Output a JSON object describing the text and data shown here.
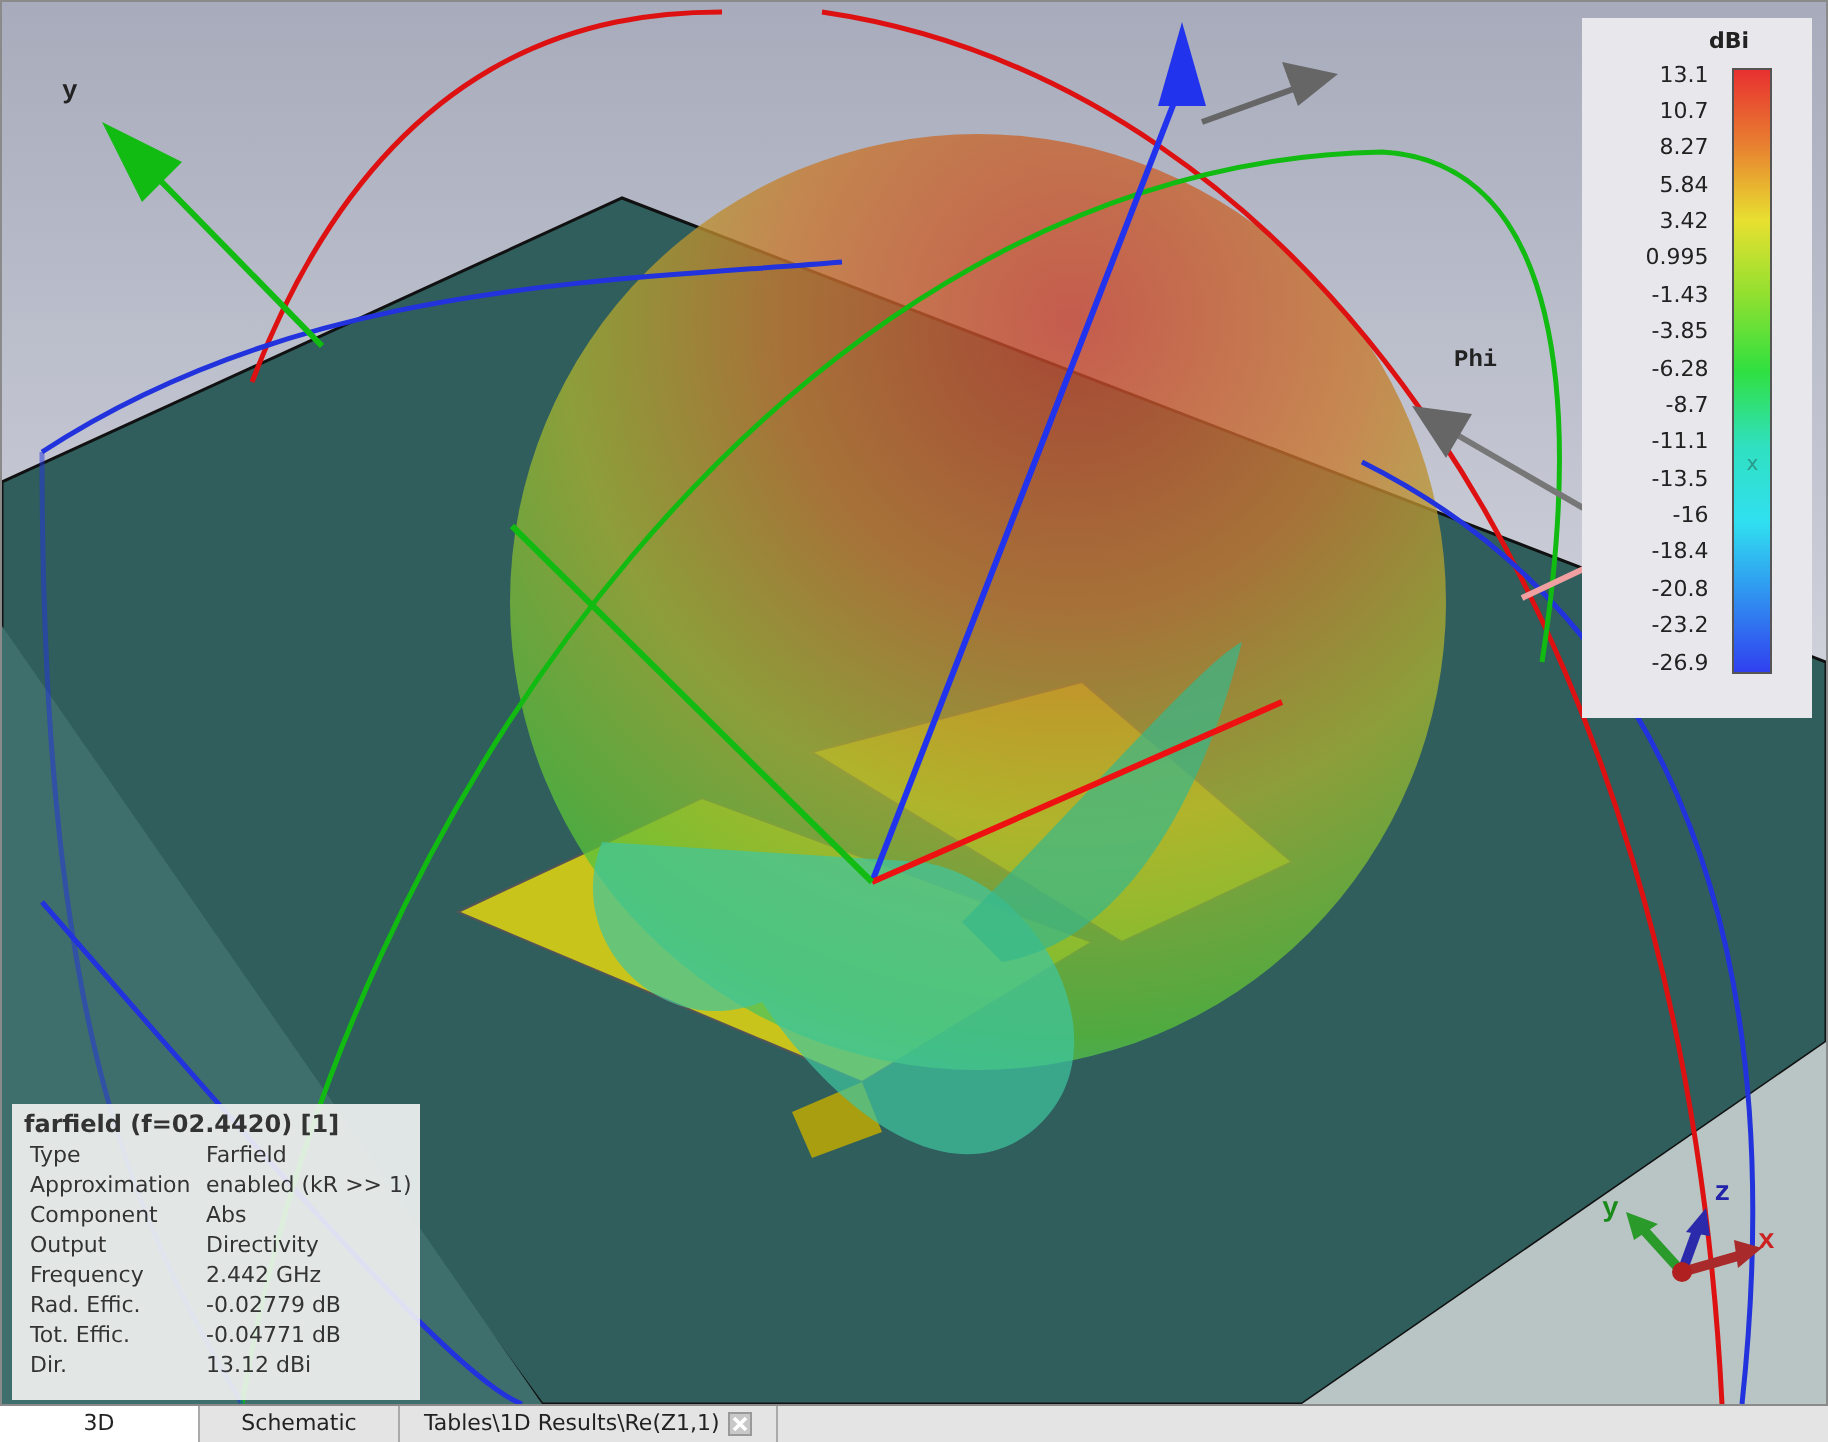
{
  "viewport": {
    "axis_label": "y",
    "phi_label": "Phi"
  },
  "legend": {
    "unit": "dBi",
    "marker_label": "x",
    "ticks": [
      "13.1",
      "10.7",
      "8.27",
      "5.84",
      "3.42",
      "0.995",
      "-1.43",
      "-3.85",
      "-6.28",
      "-8.7",
      "-11.1",
      "-13.5",
      "-16",
      "-18.4",
      "-20.8",
      "-23.2",
      "-26.9"
    ]
  },
  "info": {
    "title": "farfield (f=02.4420) [1]",
    "rows": [
      {
        "label": "Type",
        "value": "Farfield"
      },
      {
        "label": "Approximation",
        "value": "enabled (kR >> 1)"
      },
      {
        "label": "Component",
        "value": "Abs"
      },
      {
        "label": "Output",
        "value": "Directivity"
      },
      {
        "label": "Frequency",
        "value": "2.442 GHz"
      },
      {
        "label": "Rad. Effic.",
        "value": "-0.02779 dB"
      },
      {
        "label": "Tot. Effic.",
        "value": "-0.04771 dB"
      },
      {
        "label": "Dir.",
        "value": "13.12 dBi"
      }
    ]
  },
  "triad": {
    "x": "x",
    "y": "y",
    "z": "z"
  },
  "tabs": [
    {
      "label": "3D",
      "selected": true,
      "closable": false
    },
    {
      "label": "Schematic",
      "selected": false,
      "closable": false
    },
    {
      "label": "Tables\\1D Results\\Re(Z1,1)",
      "selected": false,
      "closable": true
    }
  ]
}
